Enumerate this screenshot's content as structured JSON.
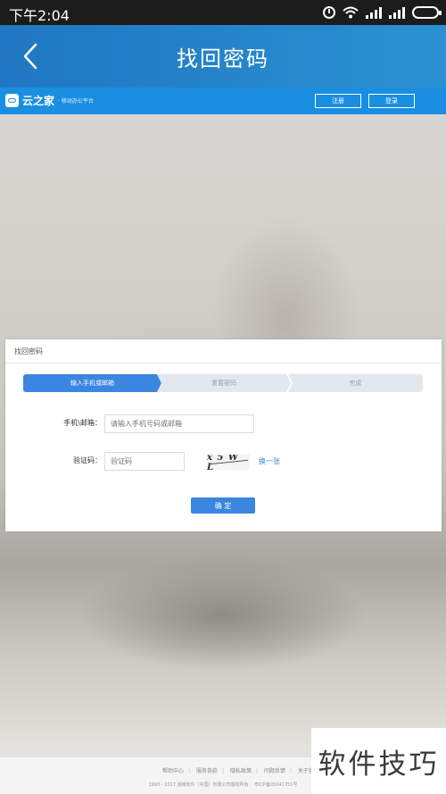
{
  "status_bar": {
    "time": "下午2:04",
    "signal1_label": "..ıll",
    "signal2_label": "..ıll"
  },
  "app_bar": {
    "title": "找回密码"
  },
  "site_bar": {
    "logo_name": "云之家",
    "logo_slogan": "· 移动办公平台",
    "register_label": "注册",
    "login_label": "登录"
  },
  "card": {
    "title": "找回密码",
    "steps": [
      "输入手机或邮箱",
      "重置密码",
      "完成"
    ],
    "phone_label": "手机\\邮箱：",
    "phone_placeholder": "请输入手机号码或邮箱",
    "code_label": "验证码：",
    "code_placeholder": "验证码",
    "captcha_text": "x 5 W L",
    "refresh_label": "换一张",
    "confirm_label": "确 定"
  },
  "footer": {
    "links": [
      "帮助中心",
      "服务条款",
      "隐私政策",
      "问题反馈",
      "关于我们"
    ],
    "copyright": "1993 - 2017 金蝶软件（中国）有限公司版权所有",
    "icp": "粤ICP备05041751号"
  },
  "watermark": "软件技巧",
  "colors": {
    "header_blue": "#1f77c1",
    "site_blue": "#1a8ee1",
    "accent": "#3b86e0"
  }
}
